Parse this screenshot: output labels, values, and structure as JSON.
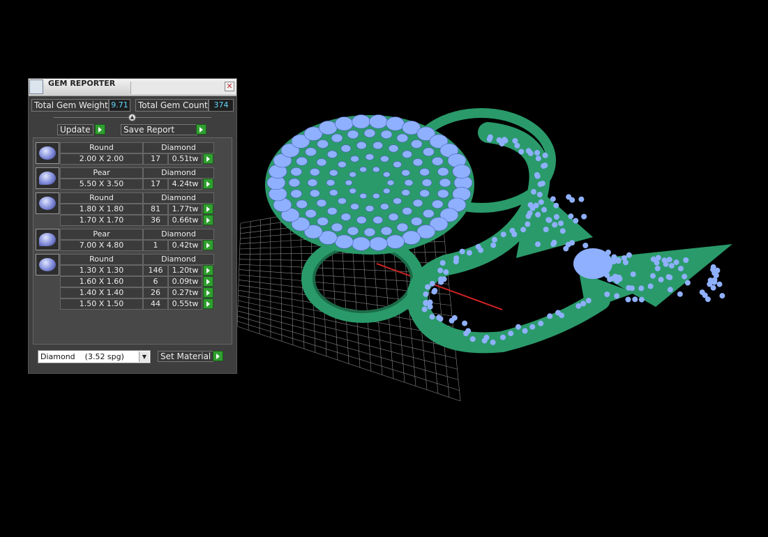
{
  "panel": {
    "title": "GEM REPORTER",
    "close_glyph": "✕",
    "total_weight_label": "Total Gem Weight",
    "total_weight_value": "9.71",
    "total_count_label": "Total Gem Count",
    "total_count_value": "374",
    "update_label": "Update",
    "save_report_label": "Save Report",
    "material_select": "Diamond    (3.52 spg)",
    "set_material_label": "Set Material"
  },
  "gems": [
    {
      "shape": "Round",
      "material": "Diamond",
      "icon": "round-gem-icon",
      "sizes": [
        {
          "size": "2.00 X 2.00",
          "count": "17",
          "weight": "0.51tw"
        }
      ]
    },
    {
      "shape": "Pear",
      "material": "Diamond",
      "icon": "pear-gem-icon",
      "sizes": [
        {
          "size": "5.50 X 3.50",
          "count": "17",
          "weight": "4.24tw"
        }
      ]
    },
    {
      "shape": "Round",
      "material": "Diamond",
      "icon": "round-gem-icon",
      "sizes": [
        {
          "size": "1.80 X 1.80",
          "count": "81",
          "weight": "1.77tw"
        },
        {
          "size": "1.70 X 1.70",
          "count": "36",
          "weight": "0.66tw"
        }
      ]
    },
    {
      "shape": "Pear",
      "material": "Diamond",
      "icon": "pear-gem-icon",
      "sizes": [
        {
          "size": "7.00 X 4.80",
          "count": "1",
          "weight": "0.42tw"
        }
      ]
    },
    {
      "shape": "Round",
      "material": "Diamond",
      "icon": "round-gem-icon",
      "sizes": [
        {
          "size": "1.30 X 1.30",
          "count": "146",
          "weight": "1.20tw"
        },
        {
          "size": "1.60 X 1.60",
          "count": "6",
          "weight": "0.09tw"
        },
        {
          "size": "1.40 X 1.40",
          "count": "26",
          "weight": "0.27tw"
        },
        {
          "size": "1.50 X 1.50",
          "count": "44",
          "weight": "0.55tw"
        }
      ]
    }
  ],
  "colors": {
    "metal": "#2a9a6a",
    "gem": "#8fb0ff",
    "grid": "#888888",
    "axis": "#cc2222"
  }
}
